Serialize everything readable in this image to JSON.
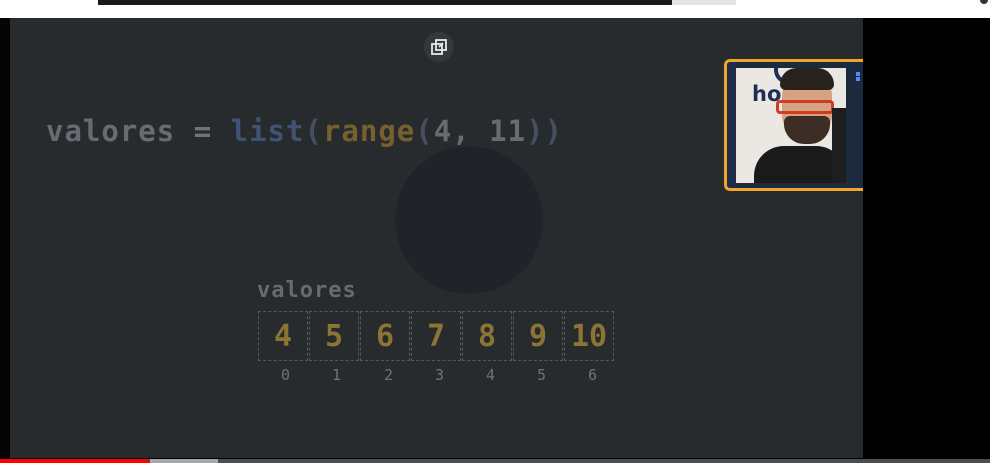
{
  "code": {
    "var": "valores",
    "eq": "=",
    "fn_list": "list",
    "open1": "(",
    "fn_range": "range",
    "open2": "(",
    "arg1": "4,",
    "arg2": "11",
    "close": "))"
  },
  "array": {
    "label": "valores",
    "values": [
      "4",
      "5",
      "6",
      "7",
      "8",
      "9",
      "10"
    ],
    "indices": [
      "0",
      "1",
      "2",
      "3",
      "4",
      "5",
      "6"
    ]
  },
  "webcam": {
    "logo_text": "ho"
  },
  "player": {
    "progress": 0.15,
    "accent_color": "#ff0000",
    "webcam_border_color": "#f2a52a"
  },
  "icons": {
    "popout": "picture-in-picture-icon"
  }
}
